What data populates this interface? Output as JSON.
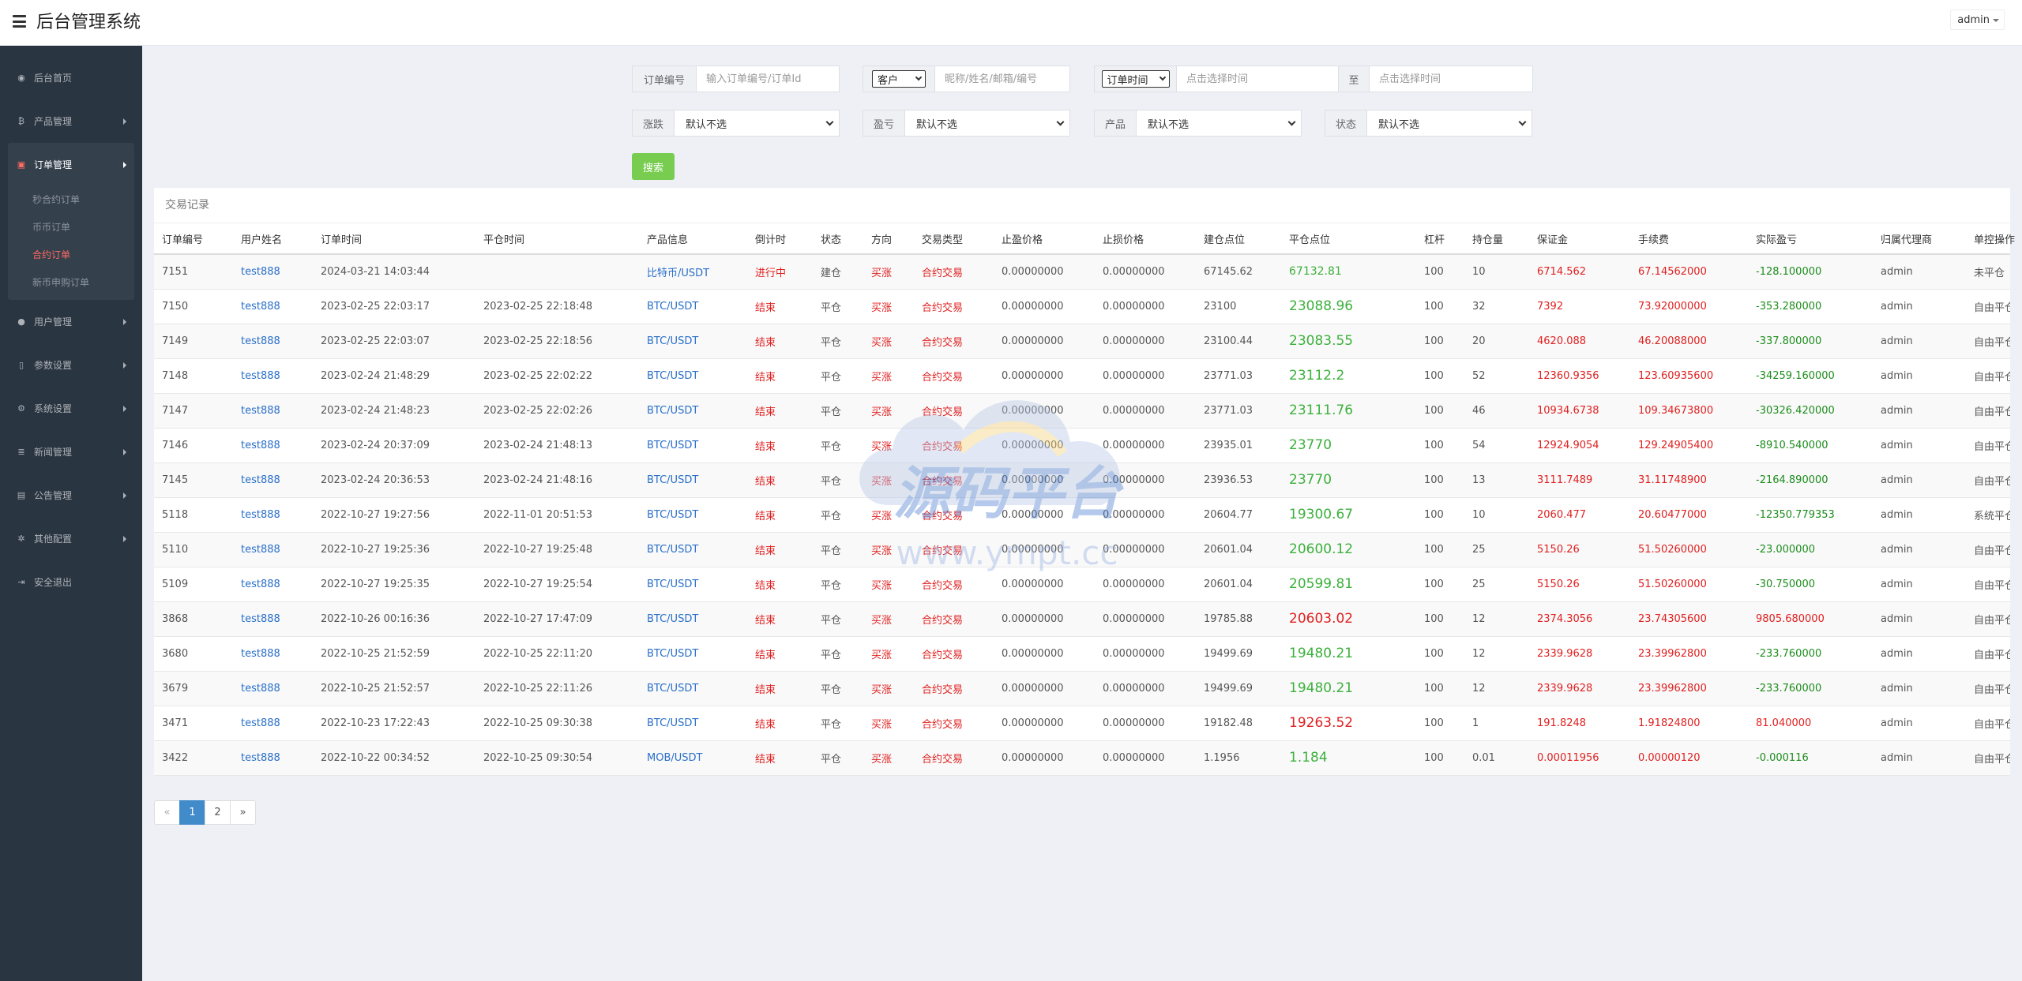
{
  "header": {
    "title": "后台管理系统",
    "user": "admin"
  },
  "sidebar": {
    "items": [
      {
        "label": "后台首页",
        "icon": "dashboard-icon",
        "glyph": "◉"
      },
      {
        "label": "产品管理",
        "icon": "bitcoin-icon",
        "glyph": "₿"
      },
      {
        "label": "订单管理",
        "icon": "orders-icon",
        "glyph": "▣"
      },
      {
        "label": "用户管理",
        "icon": "user-icon",
        "glyph": "●"
      },
      {
        "label": "参数设置",
        "icon": "file-icon",
        "glyph": "▯"
      },
      {
        "label": "系统设置",
        "icon": "gears-icon",
        "glyph": "⚙"
      },
      {
        "label": "新闻管理",
        "icon": "news-icon",
        "glyph": "≣"
      },
      {
        "label": "公告管理",
        "icon": "notice-icon",
        "glyph": "▤"
      },
      {
        "label": "其他配置",
        "icon": "gear-icon",
        "glyph": "✲"
      },
      {
        "label": "安全退出",
        "icon": "logout-icon",
        "glyph": "⇥"
      }
    ],
    "orders_sub": [
      "秒合约订单",
      "币币订单",
      "合约订单",
      "新币申购订单"
    ]
  },
  "filters": {
    "order_no_label": "订单编号",
    "order_no_placeholder": "输入订单编号/订单Id",
    "customer_select": "客户",
    "customer_placeholder": "昵称/姓名/邮箱/编号",
    "time_select": "订单时间",
    "time_start_placeholder": "点击选择时间",
    "time_to": "至",
    "time_end_placeholder": "点击选择时间",
    "rise_fall_label": "涨跌",
    "rise_fall_value": "默认不选",
    "profit_label": "盈亏",
    "profit_value": "默认不选",
    "product_label": "产品",
    "product_value": "默认不选",
    "status_label": "状态",
    "status_value": "默认不选",
    "search_button": "搜索"
  },
  "panel": {
    "title": "交易记录",
    "headers": [
      "订单编号",
      "用户姓名",
      "订单时间",
      "平仓时间",
      "产品信息",
      "倒计时",
      "状态",
      "方向",
      "交易类型",
      "止盈价格",
      "止损价格",
      "建仓点位",
      "平仓点位",
      "杠杆",
      "持仓量",
      "保证金",
      "手续费",
      "实际盈亏",
      "归属代理商",
      "单控操作"
    ],
    "rows": [
      [
        "7151",
        "test888",
        "2024-03-21 14:03:44",
        "",
        "比特币/USDT",
        "进行中",
        "建仓",
        "买涨",
        "合约交易",
        "0.00000000",
        "0.00000000",
        "67145.62",
        "67132.81",
        "100",
        "10",
        "6714.562",
        "67.14562000",
        "-128.100000",
        "admin",
        "未平仓"
      ],
      [
        "7150",
        "test888",
        "2023-02-25 22:03:17",
        "2023-02-25 22:18:48",
        "BTC/USDT",
        "结束",
        "平仓",
        "买涨",
        "合约交易",
        "0.00000000",
        "0.00000000",
        "23100",
        "23088.96",
        "100",
        "32",
        "7392",
        "73.92000000",
        "-353.280000",
        "admin",
        "自由平仓"
      ],
      [
        "7149",
        "test888",
        "2023-02-25 22:03:07",
        "2023-02-25 22:18:56",
        "BTC/USDT",
        "结束",
        "平仓",
        "买涨",
        "合约交易",
        "0.00000000",
        "0.00000000",
        "23100.44",
        "23083.55",
        "100",
        "20",
        "4620.088",
        "46.20088000",
        "-337.800000",
        "admin",
        "自由平仓"
      ],
      [
        "7148",
        "test888",
        "2023-02-24 21:48:29",
        "2023-02-25 22:02:22",
        "BTC/USDT",
        "结束",
        "平仓",
        "买涨",
        "合约交易",
        "0.00000000",
        "0.00000000",
        "23771.03",
        "23112.2",
        "100",
        "52",
        "12360.9356",
        "123.60935600",
        "-34259.160000",
        "admin",
        "自由平仓"
      ],
      [
        "7147",
        "test888",
        "2023-02-24 21:48:23",
        "2023-02-25 22:02:26",
        "BTC/USDT",
        "结束",
        "平仓",
        "买涨",
        "合约交易",
        "0.00000000",
        "0.00000000",
        "23771.03",
        "23111.76",
        "100",
        "46",
        "10934.6738",
        "109.34673800",
        "-30326.420000",
        "admin",
        "自由平仓"
      ],
      [
        "7146",
        "test888",
        "2023-02-24 20:37:09",
        "2023-02-24 21:48:13",
        "BTC/USDT",
        "结束",
        "平仓",
        "买涨",
        "合约交易",
        "0.00000000",
        "0.00000000",
        "23935.01",
        "23770",
        "100",
        "54",
        "12924.9054",
        "129.24905400",
        "-8910.540000",
        "admin",
        "自由平仓"
      ],
      [
        "7145",
        "test888",
        "2023-02-24 20:36:53",
        "2023-02-24 21:48:16",
        "BTC/USDT",
        "结束",
        "平仓",
        "买涨",
        "合约交易",
        "0.00000000",
        "0.00000000",
        "23936.53",
        "23770",
        "100",
        "13",
        "3111.7489",
        "31.11748900",
        "-2164.890000",
        "admin",
        "自由平仓"
      ],
      [
        "5118",
        "test888",
        "2022-10-27 19:27:56",
        "2022-11-01 20:51:53",
        "BTC/USDT",
        "结束",
        "平仓",
        "买涨",
        "合约交易",
        "0.00000000",
        "0.00000000",
        "20604.77",
        "19300.67",
        "100",
        "10",
        "2060.477",
        "20.60477000",
        "-12350.779353",
        "admin",
        "系统平仓"
      ],
      [
        "5110",
        "test888",
        "2022-10-27 19:25:36",
        "2022-10-27 19:25:48",
        "BTC/USDT",
        "结束",
        "平仓",
        "买涨",
        "合约交易",
        "0.00000000",
        "0.00000000",
        "20601.04",
        "20600.12",
        "100",
        "25",
        "5150.26",
        "51.50260000",
        "-23.000000",
        "admin",
        "自由平仓"
      ],
      [
        "5109",
        "test888",
        "2022-10-27 19:25:35",
        "2022-10-27 19:25:54",
        "BTC/USDT",
        "结束",
        "平仓",
        "买涨",
        "合约交易",
        "0.00000000",
        "0.00000000",
        "20601.04",
        "20599.81",
        "100",
        "25",
        "5150.26",
        "51.50260000",
        "-30.750000",
        "admin",
        "自由平仓"
      ],
      [
        "3868",
        "test888",
        "2022-10-26 00:16:36",
        "2022-10-27 17:47:09",
        "BTC/USDT",
        "结束",
        "平仓",
        "买涨",
        "合约交易",
        "0.00000000",
        "0.00000000",
        "19785.88",
        "20603.02",
        "100",
        "12",
        "2374.3056",
        "23.74305600",
        "9805.680000",
        "admin",
        "自由平仓"
      ],
      [
        "3680",
        "test888",
        "2022-10-25 21:52:59",
        "2022-10-25 22:11:20",
        "BTC/USDT",
        "结束",
        "平仓",
        "买涨",
        "合约交易",
        "0.00000000",
        "0.00000000",
        "19499.69",
        "19480.21",
        "100",
        "12",
        "2339.9628",
        "23.39962800",
        "-233.760000",
        "admin",
        "自由平仓"
      ],
      [
        "3679",
        "test888",
        "2022-10-25 21:52:57",
        "2022-10-25 22:11:26",
        "BTC/USDT",
        "结束",
        "平仓",
        "买涨",
        "合约交易",
        "0.00000000",
        "0.00000000",
        "19499.69",
        "19480.21",
        "100",
        "12",
        "2339.9628",
        "23.39962800",
        "-233.760000",
        "admin",
        "自由平仓"
      ],
      [
        "3471",
        "test888",
        "2022-10-23 17:22:43",
        "2022-10-25 09:30:38",
        "BTC/USDT",
        "结束",
        "平仓",
        "买涨",
        "合约交易",
        "0.00000000",
        "0.00000000",
        "19182.48",
        "19263.52",
        "100",
        "1",
        "191.8248",
        "1.91824800",
        "81.040000",
        "admin",
        "自由平仓"
      ],
      [
        "3422",
        "test888",
        "2022-10-22 00:34:52",
        "2022-10-25 09:30:54",
        "MOB/USDT",
        "结束",
        "平仓",
        "买涨",
        "合约交易",
        "0.00000000",
        "0.00000000",
        "1.1956",
        "1.184",
        "100",
        "0.01",
        "0.00011956",
        "0.00000120",
        "-0.000116",
        "admin",
        "自由平仓"
      ]
    ]
  },
  "pagination": {
    "prev": "«",
    "pages": [
      "1",
      "2"
    ],
    "next": "»",
    "current": "1"
  },
  "watermark": {
    "text": "源码平台",
    "url": "www.ympt.cc"
  }
}
